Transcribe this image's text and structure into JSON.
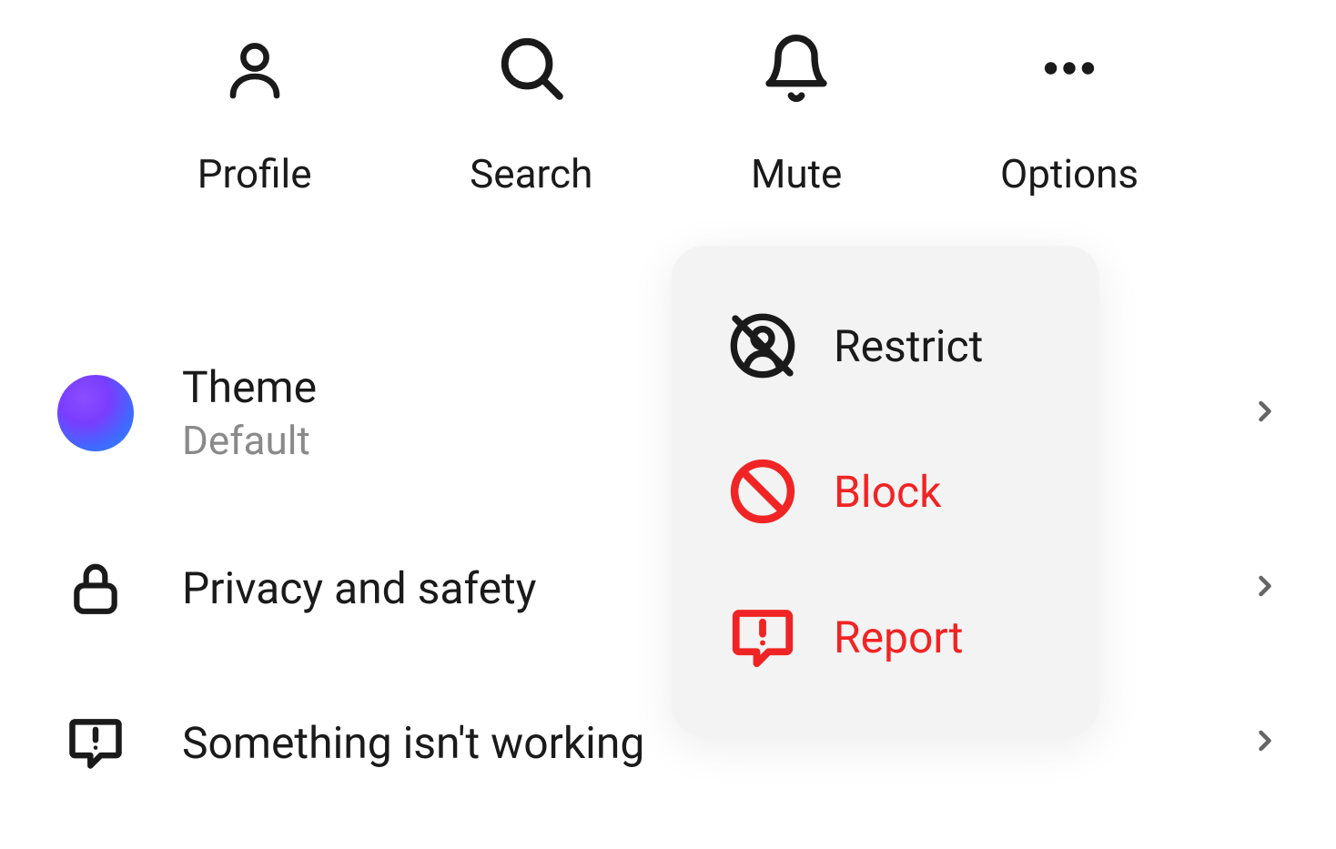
{
  "top_actions": {
    "profile": "Profile",
    "search": "Search",
    "mute": "Mute",
    "options": "Options"
  },
  "settings": {
    "theme": {
      "title": "Theme",
      "subtitle": "Default"
    },
    "privacy": {
      "title": "Privacy and safety"
    },
    "feedback": {
      "title": "Something isn't working"
    }
  },
  "options_menu": {
    "restrict": "Restrict",
    "block": "Block",
    "report": "Report"
  }
}
